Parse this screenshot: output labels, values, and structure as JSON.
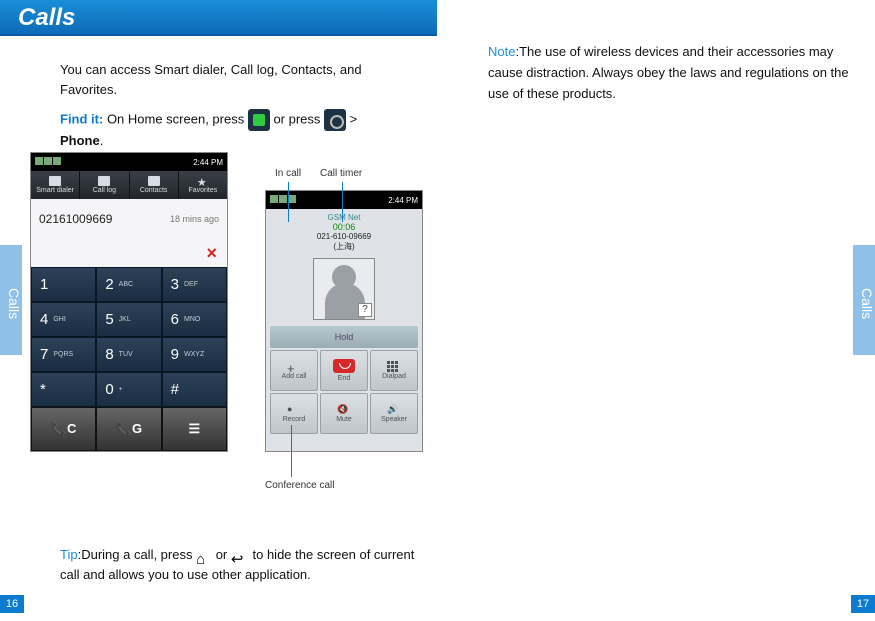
{
  "header": {
    "title": "Calls"
  },
  "tabs": {
    "left_label": "Calls",
    "right_label": "Calls"
  },
  "pagenum": {
    "left": "16",
    "right": "17"
  },
  "left": {
    "p1": "You can access Smart dialer, Call log, Contacts, and Favorites.",
    "find_it": "Find it:",
    "find_line_a": " On Home screen, press ",
    "find_line_b": " or press ",
    "gt": " >",
    "phone_word": "Phone",
    "dot": ".",
    "callout_incall": "In call",
    "callout_timer": "Call timer",
    "callout_conference": "Conference call",
    "tip_label": "Tip",
    "tip_colon": ":",
    "tip_a": "During a call, press ",
    "tip_b": " or ",
    "tip_c": " to hide the screen of current call and allows you to use other application."
  },
  "right": {
    "note_label": "Note",
    "note_colon": ":",
    "note_body": "The use of wireless devices and their accessories may cause distraction. Always obey the laws and regulations on the use of these products."
  },
  "phone1": {
    "status_time": "2:44 PM",
    "tabs": [
      "Smart dialer",
      "Call log",
      "Contacts",
      "Favorites"
    ],
    "recent_number": "02161009669",
    "recent_time": "18 mins ago",
    "keys": [
      {
        "n": "1",
        "s": ""
      },
      {
        "n": "2",
        "s": "ABC"
      },
      {
        "n": "3",
        "s": "DEF"
      },
      {
        "n": "4",
        "s": "GHI"
      },
      {
        "n": "5",
        "s": "JKL"
      },
      {
        "n": "6",
        "s": "MNO"
      },
      {
        "n": "7",
        "s": "PQRS"
      },
      {
        "n": "8",
        "s": "TUV"
      },
      {
        "n": "9",
        "s": "WXYZ"
      },
      {
        "n": "*",
        "s": ""
      },
      {
        "n": "0",
        "s": "+"
      },
      {
        "n": "#",
        "s": ""
      }
    ],
    "bottom": [
      "📞C",
      "📞G",
      "☰"
    ]
  },
  "phone2": {
    "status_time": "2:44 PM",
    "network": "GSM Net",
    "timer": "00:06",
    "number": "021-610-09669",
    "location": "(上海)",
    "hold": "Hold",
    "btns": [
      "Add call",
      "End",
      "Dialpad",
      "Record",
      "Mute",
      "Speaker"
    ]
  }
}
